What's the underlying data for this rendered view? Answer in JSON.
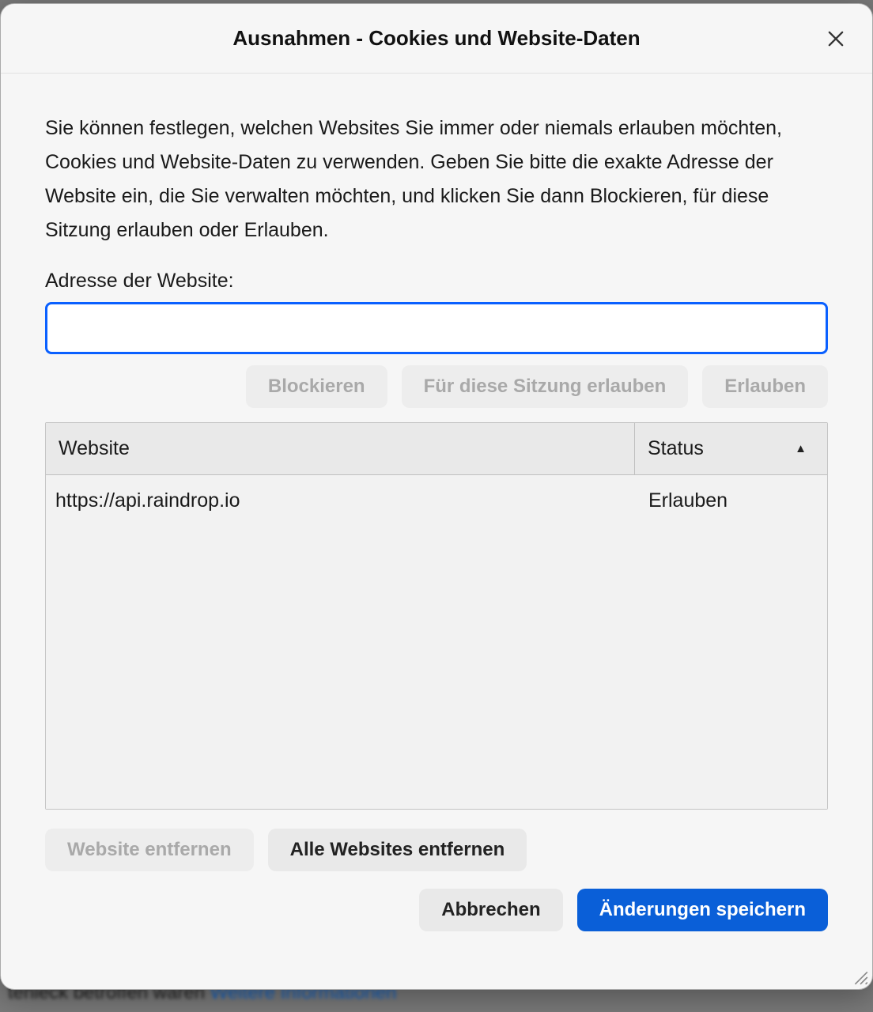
{
  "background": {
    "partial_text_left": "tenleck betroffen waren",
    "partial_link": "Weitere Informationen"
  },
  "dialog": {
    "title": "Ausnahmen - Cookies und Website-Daten",
    "description": "Sie können festlegen, welchen Websites Sie immer oder niemals erlauben möchten, Cookies und Website-Daten zu verwenden. Geben Sie bitte die exakte Adresse der Website ein, die Sie verwalten möchten, und klicken Sie dann Blockieren, für diese Sitzung erlauben oder Erlauben.",
    "input_label": "Adresse der Website:",
    "input_value": "",
    "buttons": {
      "block": "Blockieren",
      "allow_session": "Für diese Sitzung erlauben",
      "allow": "Erlauben",
      "remove_site": "Website entfernen",
      "remove_all": "Alle Websites entfernen",
      "cancel": "Abbrechen",
      "save": "Änderungen speichern"
    },
    "table": {
      "col_website": "Website",
      "col_status": "Status",
      "rows": [
        {
          "website": "https://api.raindrop.io",
          "status": "Erlauben"
        }
      ]
    }
  }
}
